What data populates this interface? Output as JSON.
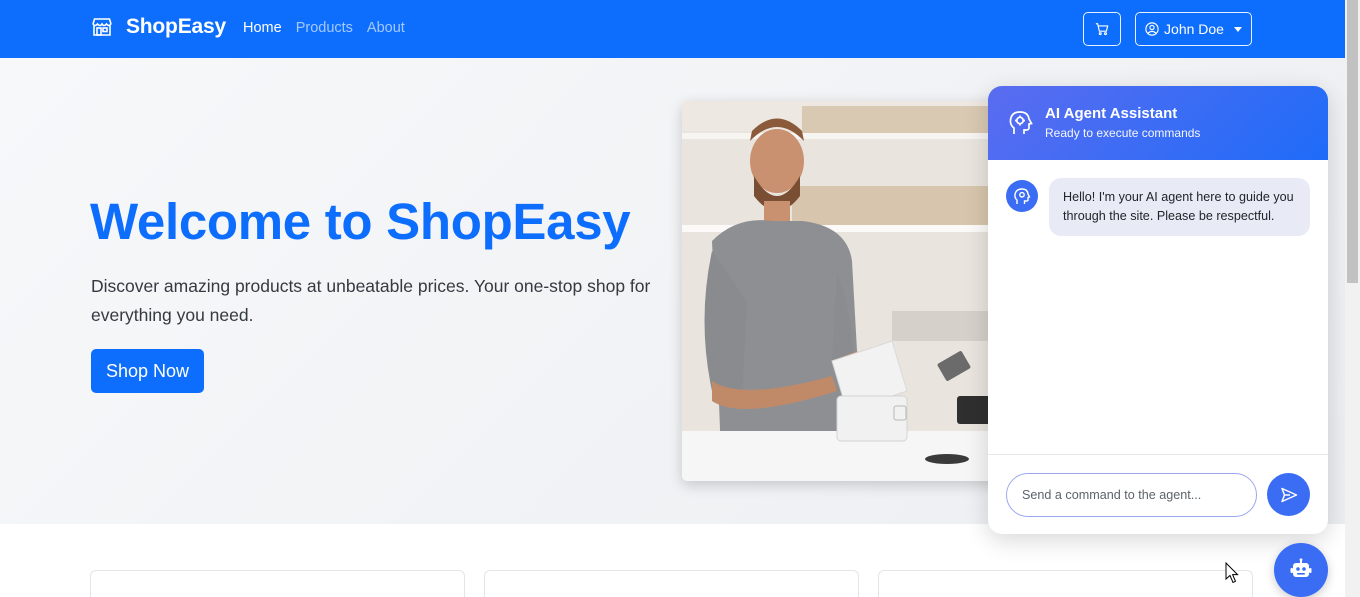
{
  "navbar": {
    "brand": "ShopEasy",
    "links": [
      {
        "label": "Home",
        "active": true
      },
      {
        "label": "Products",
        "active": false
      },
      {
        "label": "About",
        "active": false
      }
    ],
    "user_name": "John Doe"
  },
  "hero": {
    "title": "Welcome to ShopEasy",
    "subtitle": "Discover amazing products at unbeatable prices. Your one-stop shop for everything you need.",
    "cta_label": "Shop Now"
  },
  "chat": {
    "title": "AI Agent Assistant",
    "status": "Ready to execute commands",
    "messages": [
      {
        "from": "agent",
        "text": "Hello! I'm your AI agent here to guide you through the site. Please be respectful."
      }
    ],
    "input_placeholder": "Send a command to the agent..."
  },
  "icons": {
    "brand": "shop-icon",
    "cart": "cart-icon",
    "user": "user-circle-icon",
    "chat_header": "agent-head-icon",
    "message_avatar": "agent-icon",
    "send": "send-icon",
    "fab": "robot-icon"
  },
  "colors": {
    "primary": "#0d6efd",
    "chat_accent": "#3a6cf4",
    "hero_bg": "#f2f3f5",
    "bubble_bg": "#e8eaf6"
  }
}
